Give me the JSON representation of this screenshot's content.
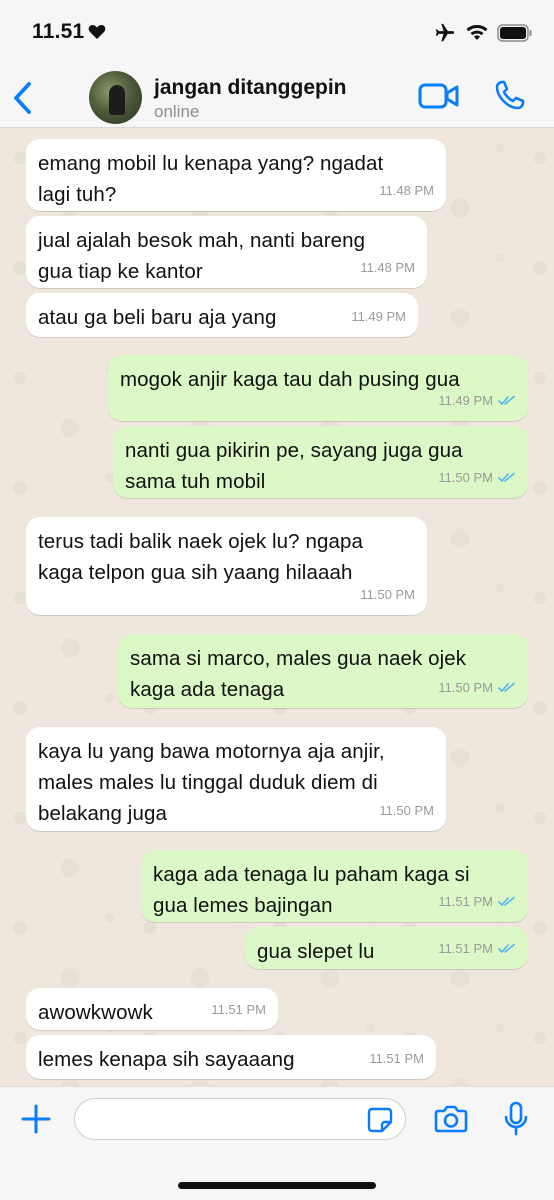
{
  "status_bar": {
    "time": "11.51"
  },
  "header": {
    "contact_name": "jangan ditanggepin",
    "contact_status": "online"
  },
  "messages": [
    {
      "dir": "in",
      "text": "emang mobil lu kenapa yang? ngadat\nlagi tuh?",
      "time": "11.48 PM"
    },
    {
      "dir": "in",
      "text": "jual ajalah besok mah, nanti bareng\ngua tiap ke kantor",
      "time": "11.48 PM"
    },
    {
      "dir": "in",
      "text": "atau ga beli baru aja yang",
      "time": "11.49 PM"
    },
    {
      "dir": "out",
      "text": "mogok anjir kaga tau dah pusing gua",
      "time": "11.49 PM"
    },
    {
      "dir": "out",
      "text": "nanti gua pikirin pe, sayang juga gua\nsama tuh mobil",
      "time": "11.50 PM"
    },
    {
      "dir": "in",
      "text": "terus tadi balik naek ojek lu? ngapa\nkaga telpon gua sih yaang hilaaah",
      "time": "11.50 PM"
    },
    {
      "dir": "out",
      "text": "sama si marco, males gua naek ojek\nkaga ada tenaga",
      "time": "11.50 PM"
    },
    {
      "dir": "in",
      "text": "kaya lu yang bawa motornya aja anjir,\nmales males lu tinggal duduk diem di\nbelakang juga",
      "time": "11.50 PM"
    },
    {
      "dir": "out",
      "text": "kaga ada tenaga lu paham kaga si\ngua lemes bajingan",
      "time": "11.51 PM"
    },
    {
      "dir": "out",
      "text": "gua slepet lu",
      "time": "11.51 PM"
    },
    {
      "dir": "in",
      "text": "awowkwowk",
      "time": "11.51 PM"
    },
    {
      "dir": "in",
      "text": "lemes kenapa sih sayaaang",
      "time": "11.51 PM"
    }
  ],
  "composer": {
    "placeholder": ""
  },
  "colors": {
    "incoming_bubble": "#ffffff",
    "outgoing_bubble": "#dcf8c6",
    "accent": "#0a7cff",
    "read_ticks": "#4fb6ec",
    "chat_background": "#efe7dd"
  },
  "icons": [
    "heart-icon",
    "airplane-icon",
    "wifi-icon",
    "battery-icon",
    "back-icon",
    "video-call-icon",
    "phone-call-icon",
    "plus-icon",
    "sticker-icon",
    "camera-icon",
    "microphone-icon",
    "read-ticks-icon"
  ]
}
